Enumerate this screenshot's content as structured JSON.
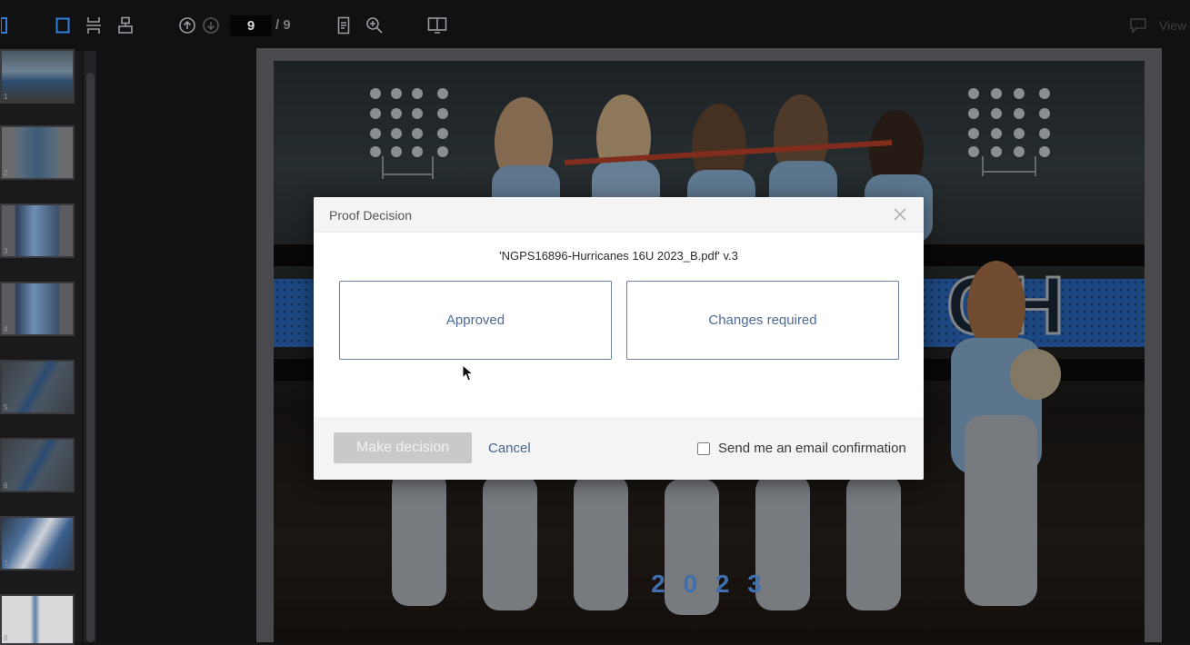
{
  "toolbar": {
    "page_current": "9",
    "page_total": "/ 9",
    "view_label": "View",
    "icons": [
      "single-page-icon",
      "continuous-scroll-icon",
      "two-page-icon",
      "page-up-icon",
      "page-down-icon",
      "fit-page-icon",
      "zoom-icon",
      "compare-icon",
      "comment-icon"
    ]
  },
  "sidebar": {
    "thumbnails": [
      {
        "num": "1"
      },
      {
        "num": "2"
      },
      {
        "num": "3"
      },
      {
        "num": "4"
      },
      {
        "num": "5"
      },
      {
        "num": "6"
      },
      {
        "num": "7"
      },
      {
        "num": "8"
      }
    ]
  },
  "poster": {
    "year_text": "2 0 2 3"
  },
  "dialog": {
    "title": "Proof Decision",
    "file_name": "'NGPS16896-Hurricanes 16U 2023_B.pdf' v.3",
    "option_approved": "Approved",
    "option_changes": "Changes required",
    "make_decision_label": "Make decision",
    "cancel_label": "Cancel",
    "email_confirm_label": "Send me an email confirmation",
    "email_confirm_checked": false
  },
  "colors": {
    "accent_text": "#4d6b96",
    "choice_border": "#6c7f9e",
    "disabled_button": "#c9c9cb"
  }
}
